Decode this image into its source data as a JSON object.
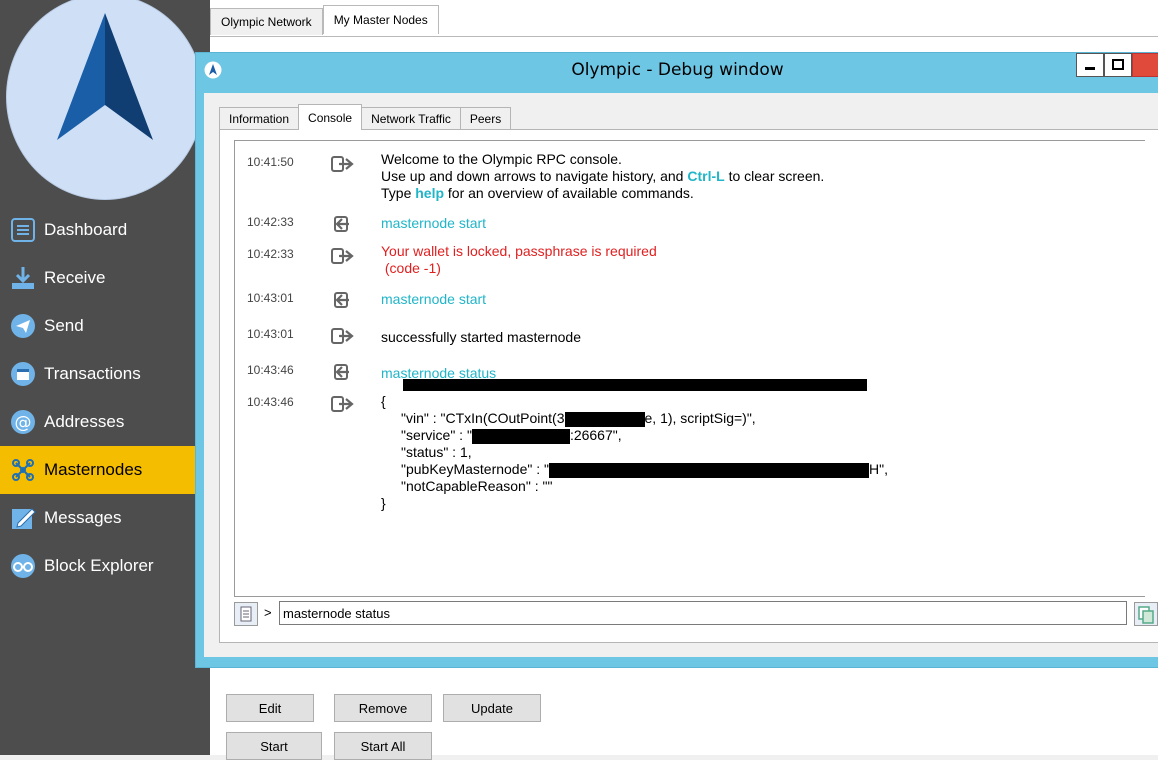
{
  "sidebar": {
    "items": [
      {
        "label": "Dashboard",
        "icon": "dashboard-icon"
      },
      {
        "label": "Receive",
        "icon": "receive-icon"
      },
      {
        "label": "Send",
        "icon": "send-icon"
      },
      {
        "label": "Transactions",
        "icon": "transactions-icon"
      },
      {
        "label": "Addresses",
        "icon": "addresses-icon"
      },
      {
        "label": "Masternodes",
        "icon": "masternodes-icon"
      },
      {
        "label": "Messages",
        "icon": "messages-icon"
      },
      {
        "label": "Block Explorer",
        "icon": "block-explorer-icon"
      }
    ],
    "active": "Masternodes"
  },
  "main": {
    "tabs": [
      "Olympic Network",
      "My Master Nodes"
    ],
    "selected_tab": "My Master Nodes",
    "buttons": {
      "edit": "Edit",
      "remove": "Remove",
      "update": "Update",
      "start": "Start",
      "start_all": "Start All"
    }
  },
  "debug": {
    "title": "Olympic - Debug window",
    "tabs": [
      "Information",
      "Console",
      "Network Traffic",
      "Peers"
    ],
    "selected_tab": "Console",
    "entries": [
      {
        "time": "10:41:50",
        "dir": "out",
        "lines": [
          "Welcome to the Olympic RPC console."
        ],
        "line2a": "Use up and down arrows to navigate history, and ",
        "line2b": "Ctrl-L",
        "line2c": " to clear screen.",
        "line3a": "Type ",
        "line3b": "help",
        "line3c": " for an overview of available commands."
      },
      {
        "time": "10:42:33",
        "dir": "in",
        "text": "masternode start"
      },
      {
        "time": "10:42:33",
        "dir": "out",
        "text": "Your wallet is locked, passphrase is required",
        "text2": " (code -1)"
      },
      {
        "time": "10:43:01",
        "dir": "in",
        "text": "masternode start"
      },
      {
        "time": "10:43:01",
        "dir": "out",
        "text": "successfully started masternode"
      },
      {
        "time": "10:43:46",
        "dir": "in",
        "text": "masternode status"
      },
      {
        "time": "10:43:46",
        "dir": "out",
        "json": [
          "{",
          "\"vin\" : \"CTxIn(COutPoint(3",
          "e, 1), scriptSig=)\",",
          "\"service\" : \"",
          ":26667\",",
          "\"status\" : 1,",
          "\"pubKeyMasternode\" : \"",
          "H\",",
          "\"notCapableReason\" : \"\"",
          "}"
        ]
      }
    ],
    "input_prompt": ">",
    "input_value": "masternode status"
  },
  "colors": {
    "sidebar_bg": "#4d4d4d",
    "active_bg": "#f5bd00",
    "titlebar": "#6dc6e4",
    "cyan_text": "#20b5c8",
    "error_text": "#e02020"
  }
}
